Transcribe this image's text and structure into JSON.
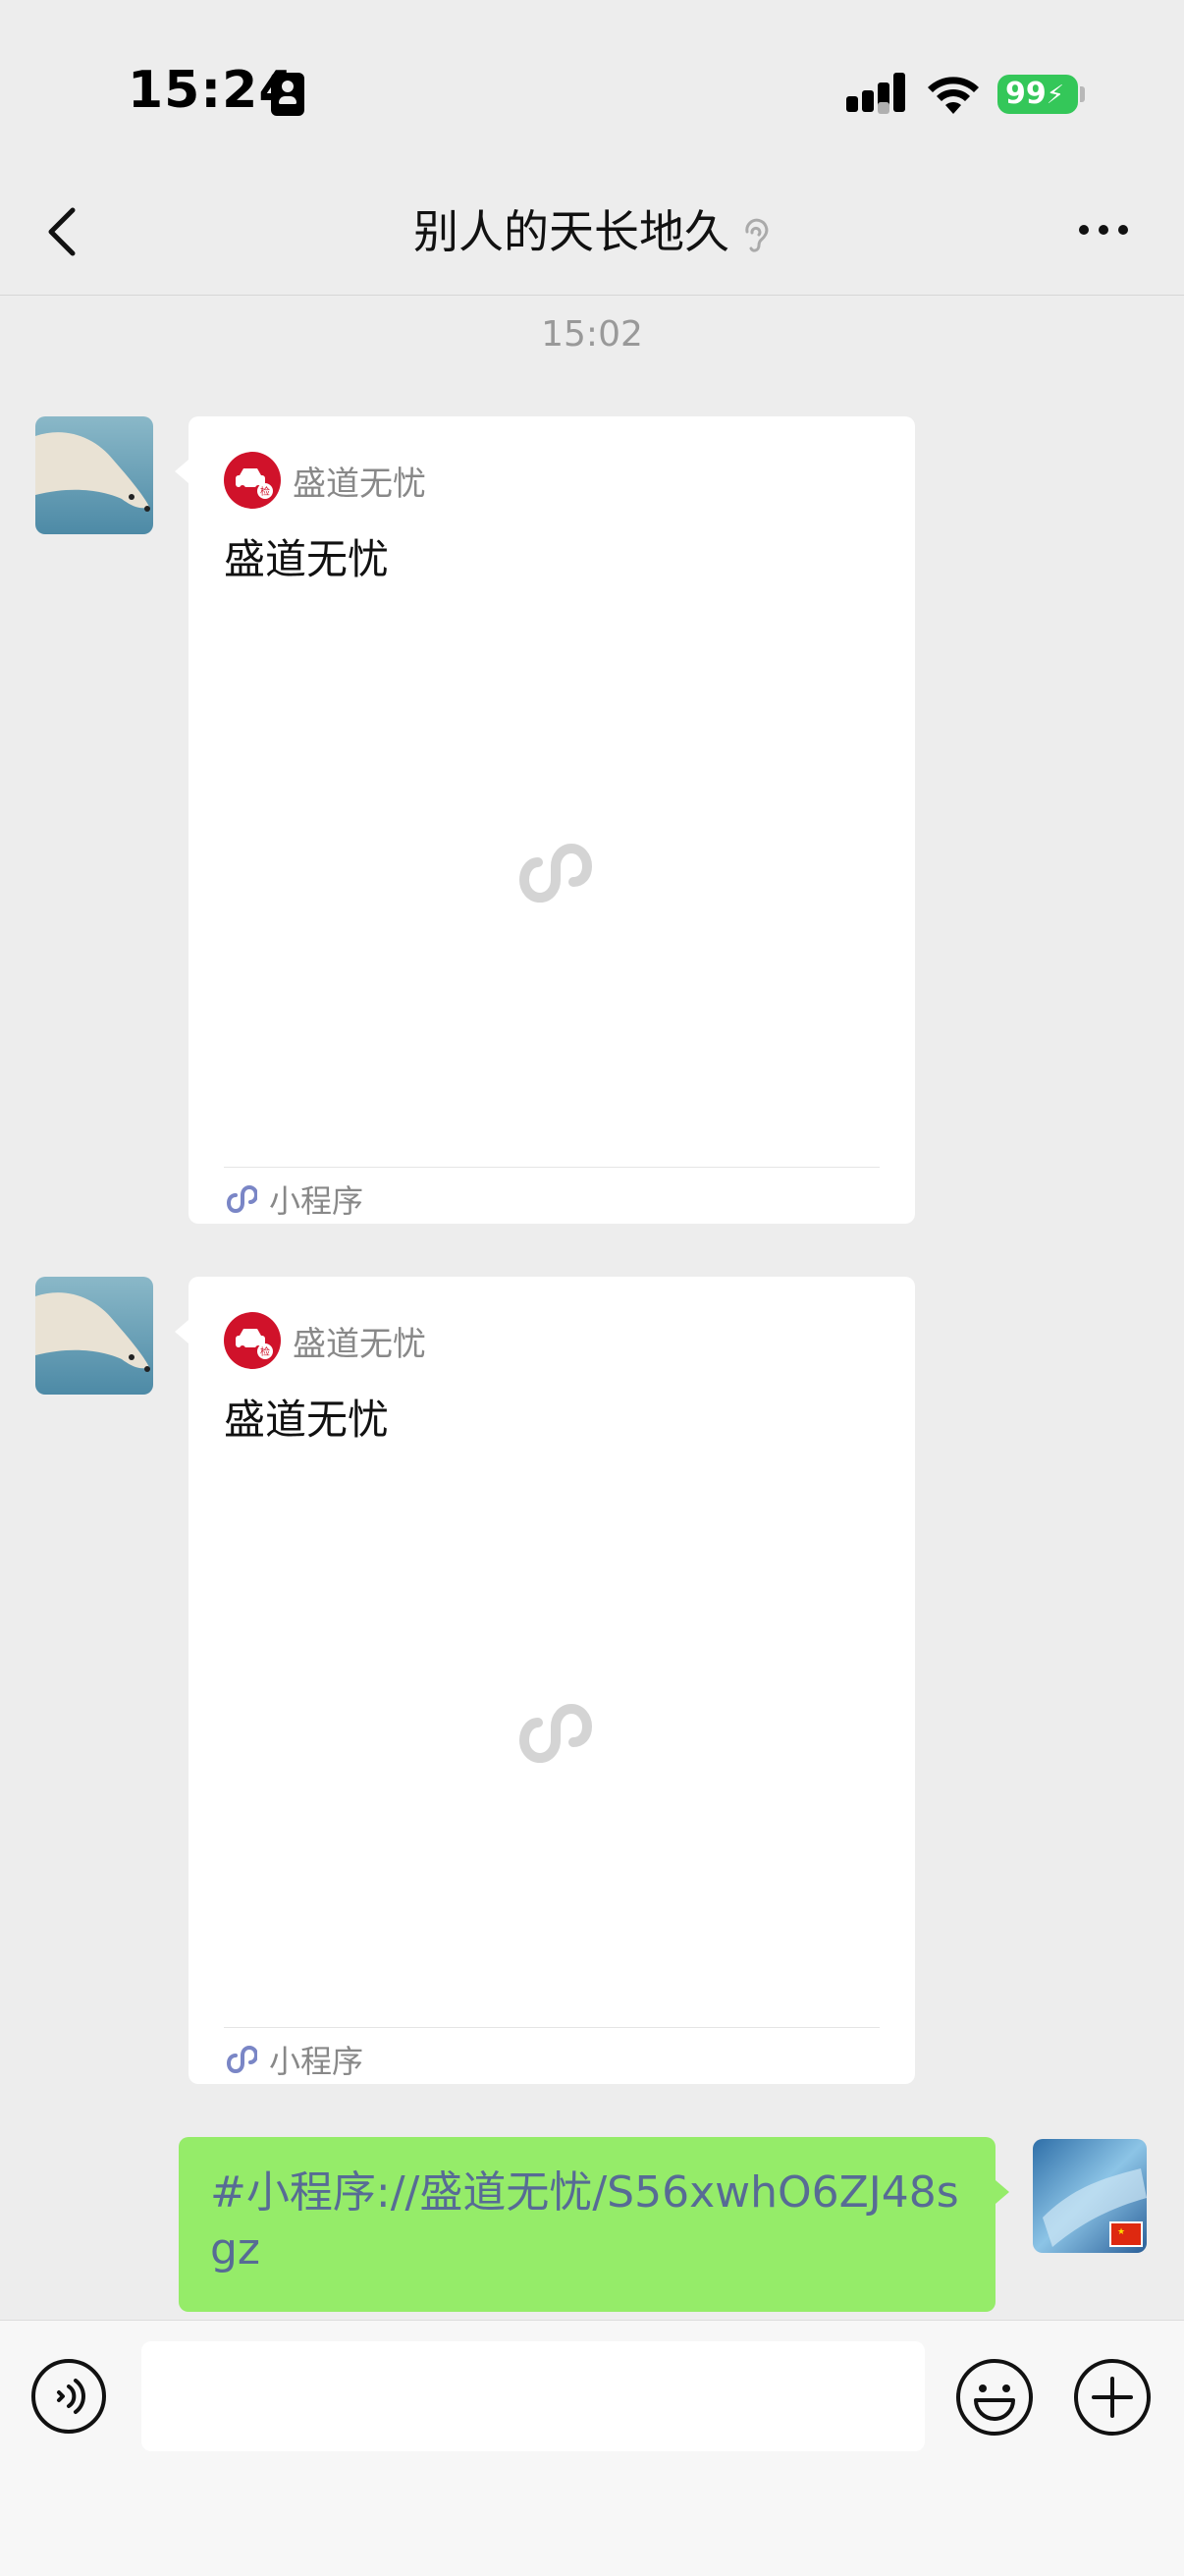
{
  "status_bar": {
    "time": "15:24",
    "battery": "99"
  },
  "header": {
    "title": "别人的天长地久"
  },
  "chat": {
    "timestamp": "15:02",
    "messages": [
      {
        "app_name": "盛道无忧",
        "title": "盛道无忧",
        "footer": "小程序"
      },
      {
        "app_name": "盛道无忧",
        "title": "盛道无忧",
        "footer": "小程序"
      }
    ],
    "sent_text": "#小程序://盛道无忧/S56xwhO6ZJ48sgz"
  },
  "input_bar": {
    "placeholder": ""
  },
  "colors": {
    "bubble_green": "#95ec69",
    "link_blue": "#576b95",
    "brand_red": "#d0122a",
    "battery_green": "#34c759"
  }
}
